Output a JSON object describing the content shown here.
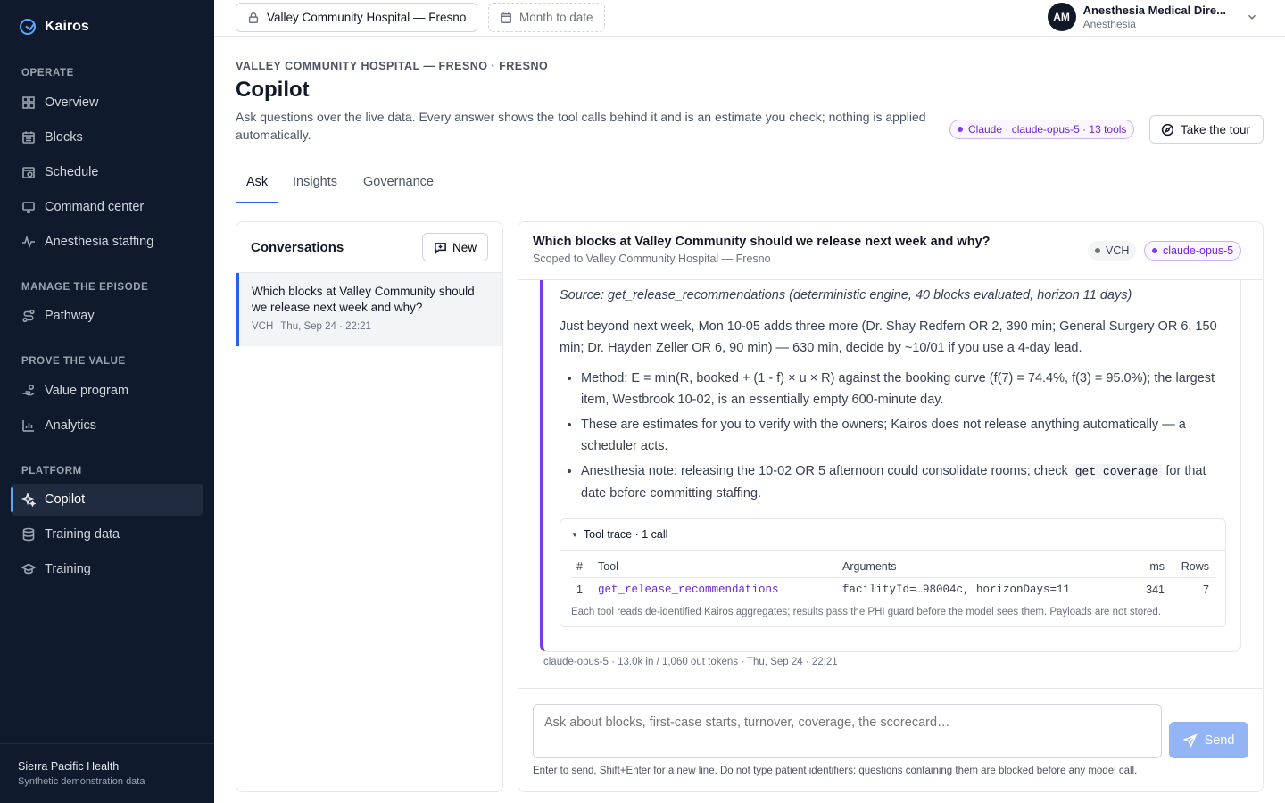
{
  "brand": {
    "name": "Kairos"
  },
  "sidebar": {
    "sections": [
      {
        "label": "OPERATE",
        "items": [
          {
            "label": "Overview",
            "icon": "grid-icon"
          },
          {
            "label": "Blocks",
            "icon": "calendar-grid-icon"
          },
          {
            "label": "Schedule",
            "icon": "calendar-clock-icon"
          },
          {
            "label": "Command center",
            "icon": "monitor-icon"
          },
          {
            "label": "Anesthesia staffing",
            "icon": "pulse-icon"
          }
        ]
      },
      {
        "label": "MANAGE THE EPISODE",
        "items": [
          {
            "label": "Pathway",
            "icon": "route-icon"
          }
        ]
      },
      {
        "label": "PROVE THE VALUE",
        "items": [
          {
            "label": "Value program",
            "icon": "hand-coins-icon"
          },
          {
            "label": "Analytics",
            "icon": "bar-chart-icon"
          }
        ]
      },
      {
        "label": "PLATFORM",
        "items": [
          {
            "label": "Copilot",
            "icon": "sparkles-icon",
            "active": true
          },
          {
            "label": "Training data",
            "icon": "database-icon"
          },
          {
            "label": "Training",
            "icon": "graduation-cap-icon"
          }
        ]
      }
    ],
    "footer": {
      "org": "Sierra Pacific Health",
      "sub": "Synthetic demonstration data"
    }
  },
  "topbar": {
    "facility": "Valley Community Hospital — Fresno",
    "period": "Month to date",
    "user": {
      "initials": "AM",
      "name": "Anesthesia Medical Dire...",
      "role": "Anesthesia"
    }
  },
  "header": {
    "eyebrow": "VALLEY COMMUNITY HOSPITAL — FRESNO · FRESNO",
    "title": "Copilot",
    "description": "Ask questions over the live data. Every answer shows the tool calls behind it and is an estimate you check; nothing is applied automatically.",
    "model_badge": "Claude · claude-opus-5 · 13 tools",
    "tour_label": "Take the tour"
  },
  "tabs": [
    "Ask",
    "Insights",
    "Governance"
  ],
  "conversations": {
    "title": "Conversations",
    "new_label": "New",
    "items": [
      {
        "text": "Which blocks at Valley Community should we release next week and why?",
        "tag": "VCH",
        "time": "Thu, Sep 24 · 22:21"
      }
    ]
  },
  "chat": {
    "question": "Which blocks at Valley Community should we release next week and why?",
    "scope": "Scoped to Valley Community Hospital — Fresno",
    "chip_site": "VCH",
    "chip_model": "claude-opus-5",
    "answer": {
      "source": "Source: get_release_recommendations (deterministic engine, 40 blocks evaluated, horizon 11 days)",
      "paragraph": "Just beyond next week, Mon 10-05 adds three more (Dr. Shay Redfern OR 2, 390 min; General Surgery OR 6, 150 min; Dr. Hayden Zeller OR 6, 90 min) — 630 min, decide by ~10/01 if you use a 4-day lead.",
      "bullet1": "Method: E = min(R, booked + (1 - f) × u × R) against the booking curve (f(7) = 74.4%, f(3) = 95.0%); the largest item, Westbrook 10-02, is an essentially empty 600-minute day.",
      "bullet2": "These are estimates for you to verify with the owners; Kairos does not release anything automatically — a scheduler acts.",
      "bullet3_pre": "Anesthesia note: releasing the 10-02 OR 5 afternoon could consolidate rooms; check ",
      "bullet3_code": "get_coverage",
      "bullet3_post": " for that date before committing staffing."
    },
    "trace": {
      "title": "Tool trace · 1 call",
      "headers": [
        "#",
        "Tool",
        "Arguments",
        "ms",
        "Rows"
      ],
      "rows": [
        {
          "n": "1",
          "tool": "get_release_recommendations",
          "args": "facilityId=…98004c, horizonDays=11",
          "ms": "341",
          "rows": "7"
        }
      ],
      "note": "Each tool reads de-identified Kairos aggregates; results pass the PHI guard before the model sees them. Payloads are not stored."
    },
    "meta": "claude-opus-5 · 13.0k in / 1,060 out tokens · Thu, Sep 24 · 22:21",
    "composer": {
      "placeholder": "Ask about blocks, first-case starts, turnover, coverage, the scorecard…",
      "send_label": "Send",
      "hint": "Enter to send, Shift+Enter for a new line. Do not type patient identifiers: questions containing them are blocked before any model call."
    }
  }
}
